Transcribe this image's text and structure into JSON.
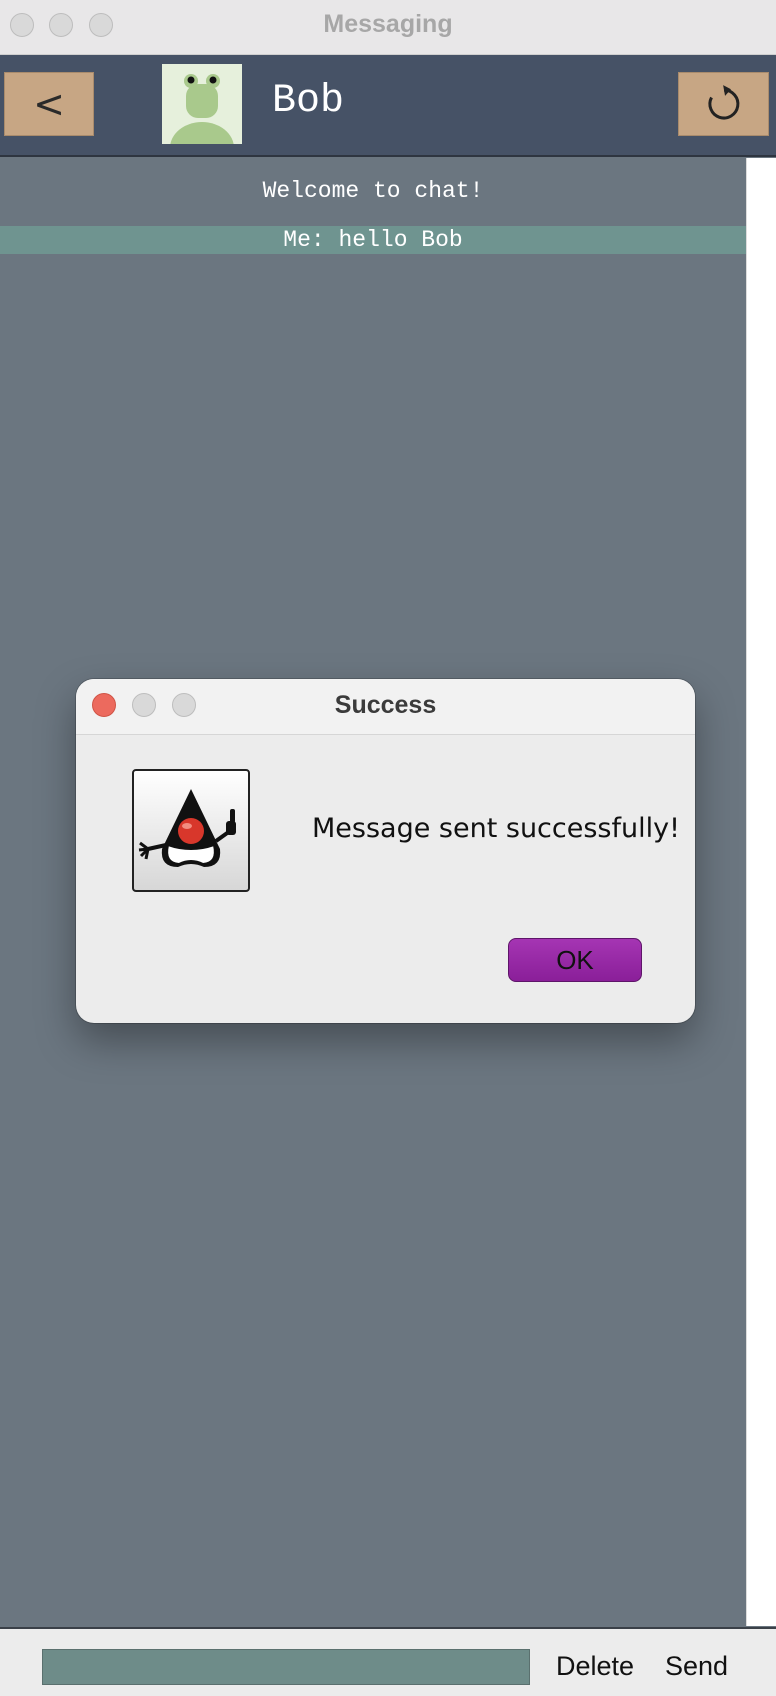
{
  "window": {
    "title": "Messaging"
  },
  "header": {
    "back_label": "<",
    "contact_name": "Bob",
    "back_icon": "chevron-left-icon",
    "refresh_icon": "refresh-icon",
    "avatar_icon": "frog-avatar-icon"
  },
  "chat": {
    "welcome_text": "Welcome to chat!",
    "messages": [
      {
        "text": "Me: hello Bob"
      }
    ]
  },
  "composer": {
    "input_value": "",
    "delete_label": "Delete",
    "send_label": "Send"
  },
  "dialog": {
    "title": "Success",
    "message": "Message sent successfully!",
    "ok_label": "OK",
    "icon": "java-duke-icon"
  },
  "colors": {
    "chat_background": "#6b7680",
    "header_background": "#465266",
    "button_tan": "#c7a684",
    "message_highlight": "#6f9490",
    "ok_button": "#9a2aa8",
    "close_red": "#ec6a5e"
  }
}
